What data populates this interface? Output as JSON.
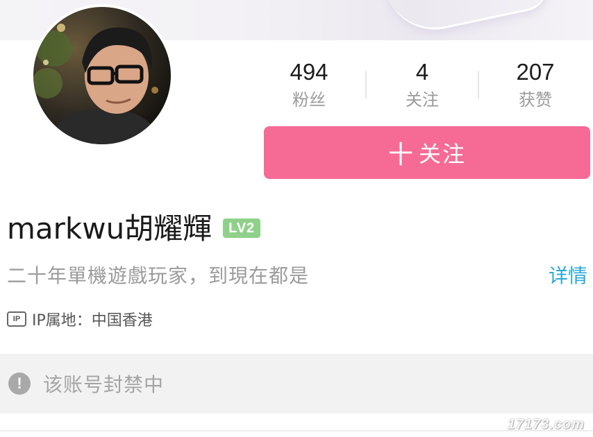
{
  "profile": {
    "username": "markwu胡耀輝",
    "level_badge": "LV2",
    "bio": "二十年單機遊戲玩家，到現在都是",
    "detail_link": "详情",
    "ip_icon": "IP",
    "ip_location": "IP属地：中国香港"
  },
  "stats": [
    {
      "value": "494",
      "label": "粉丝"
    },
    {
      "value": "4",
      "label": "关注"
    },
    {
      "value": "207",
      "label": "获赞"
    }
  ],
  "follow_button": {
    "plus": "十",
    "label": "关注"
  },
  "ban_notice": {
    "icon": "!",
    "text": "该账号封禁中"
  },
  "watermark": "17173.com",
  "colors": {
    "follow_button": "#f56b96",
    "level_badge": "#8fd18a",
    "detail_link": "#2aa8d8",
    "ban_bar": "#f2f2f2"
  }
}
